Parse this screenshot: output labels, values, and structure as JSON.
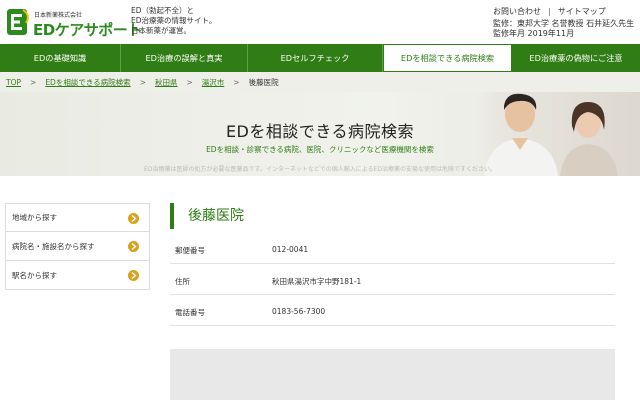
{
  "header": {
    "logo_small": "日本新薬株式会社",
    "logo_main": "EDケアサポート",
    "tagline": [
      "ED（勃起不全）と",
      "ED治療薬の情報サイト。",
      "日本新薬が運営。"
    ],
    "top_links": [
      "お問い合わせ",
      "サイトマップ"
    ],
    "supervisor": [
      "監修：東邦大学 名誉教授 石井延久先生",
      "監修年月 2019年11月"
    ]
  },
  "nav": {
    "items": [
      {
        "label": "EDの基礎知識",
        "active": false
      },
      {
        "label": "ED治療の誤解と真実",
        "active": false
      },
      {
        "label": "EDセルフチェック",
        "active": false
      },
      {
        "label": "EDを相談できる病院検索",
        "active": true
      },
      {
        "label": "ED治療薬の偽物にご注意",
        "active": false
      }
    ]
  },
  "breadcrumb": {
    "items": [
      "TOP",
      "EDを相談できる病院検索",
      "秋田県",
      "湯沢市"
    ],
    "current": "後藤医院"
  },
  "hero": {
    "title": "EDを相談できる病院検索",
    "subtitle": "EDを相談・診察できる病院、医院、クリニックなど医療機関を検索",
    "note": "ED治療薬は医師の処方が必要な医薬品です。インターネットなどでの個人輸入によるED治療薬の安易な使用は危険ですください。"
  },
  "sidebar": {
    "items": [
      {
        "label": "地域から探す"
      },
      {
        "label": "病院名・施設名から探す"
      },
      {
        "label": "駅名から探す"
      }
    ]
  },
  "clinic": {
    "name": "後藤医院",
    "rows": [
      {
        "label": "郵便番号",
        "value": "012-0041"
      },
      {
        "label": "住所",
        "value": "秋田県湯沢市字中野181-1"
      },
      {
        "label": "電話番号",
        "value": "0183-56-7300"
      }
    ]
  },
  "colors": {
    "brand_green": "#2f7d14",
    "accent_gold": "#d8a21c"
  }
}
